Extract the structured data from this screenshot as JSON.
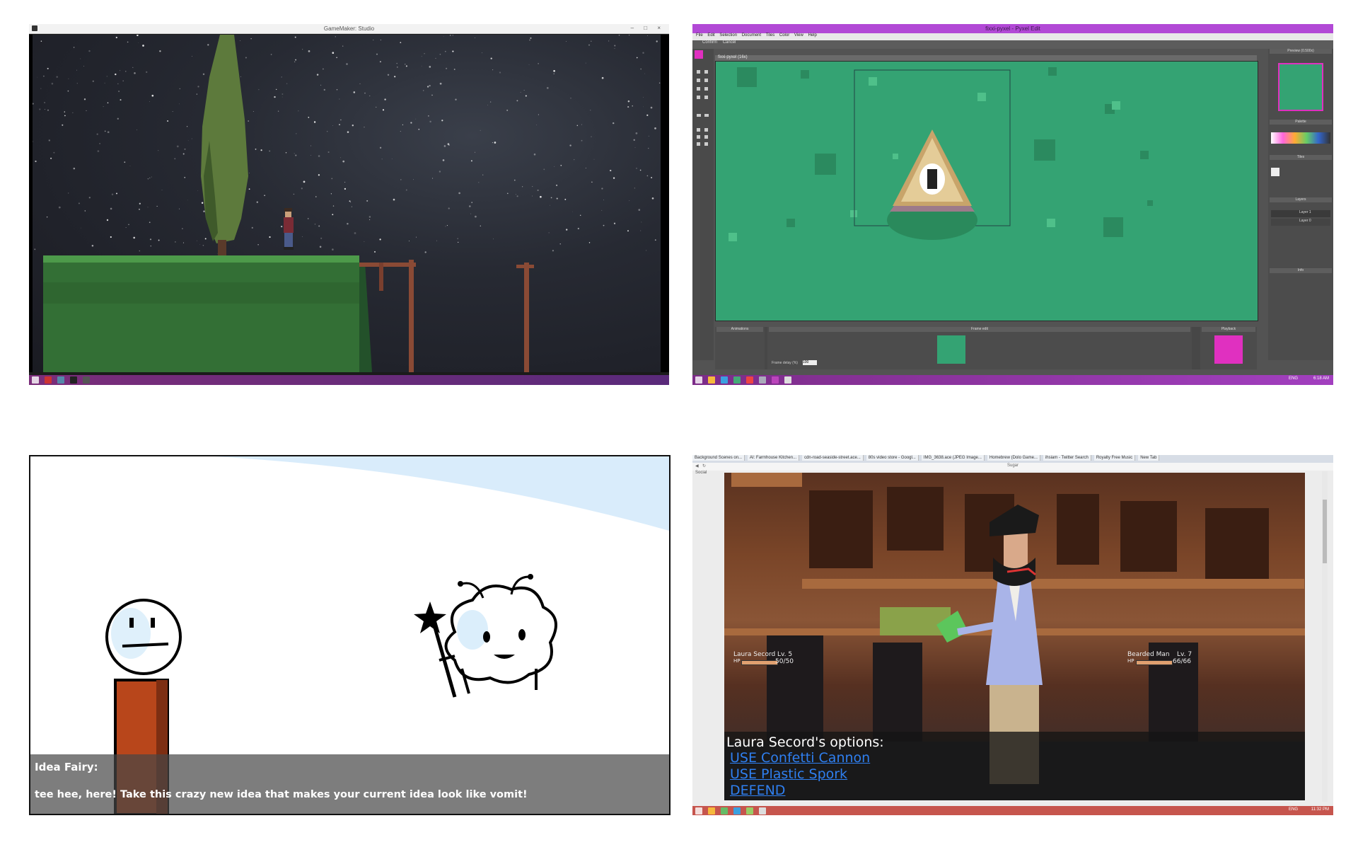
{
  "panel1": {
    "window_title": "GameMaker: Studio",
    "window_controls": "– □ ×"
  },
  "panel2": {
    "window_title": "fixxi-pyxel - Pyxel Edit",
    "menu": [
      "File",
      "Edit",
      "Selection",
      "Document",
      "Tiles",
      "Color",
      "View",
      "Help"
    ],
    "toolbar": [
      "Confirm",
      "Cancel"
    ],
    "canvas_tab": "fixxi-pyxel (16x)",
    "right_panels": [
      "Preview (0.500x)",
      "Palette",
      "Tiles",
      "Layers",
      "Info"
    ],
    "layers": [
      "Layer 1",
      "Layer 0"
    ],
    "bottom_panels": [
      "Animations",
      "Frame edit",
      "Playback"
    ],
    "frame_delay_label": "Frame delay (%)",
    "frame_delay_value": "100",
    "tray_text": "ENG",
    "clock": "6:18 AM",
    "accent": "#b249d6",
    "canvas_color": "#34a373"
  },
  "panel3": {
    "speaker": "Idea Fairy:",
    "dialogue": "tee hee, here! Take this crazy new idea that makes your current idea look like vomit!"
  },
  "panel4": {
    "tabs": [
      "Background Scenes on...",
      "AI: Farmhouse Kitchen...",
      "cdn-road-seaside-street.ace...",
      "80s video store - Googl...",
      "IMG_3638.ace (JPEG Image...",
      "Homebrew (Dolo Game...",
      "ihsiam - Twitter Search",
      "Royalty Free Music",
      "New Tab"
    ],
    "page_title": "Sugar",
    "bookmark": "Social",
    "player": {
      "name": "Laura Secord",
      "level": "Lv. 5",
      "hp_label": "HP",
      "hp": "50/50"
    },
    "enemy": {
      "name": "Bearded Man",
      "level": "Lv. 7",
      "hp_label": "HP",
      "hp": "66/66"
    },
    "options_header": "Laura Secord's options:",
    "options": [
      "USE Confetti Cannon",
      "USE Plastic Spork",
      "DEFEND"
    ],
    "tray_text": "ENG",
    "clock": "11:32 PM",
    "link_color": "#2f7ff0"
  }
}
